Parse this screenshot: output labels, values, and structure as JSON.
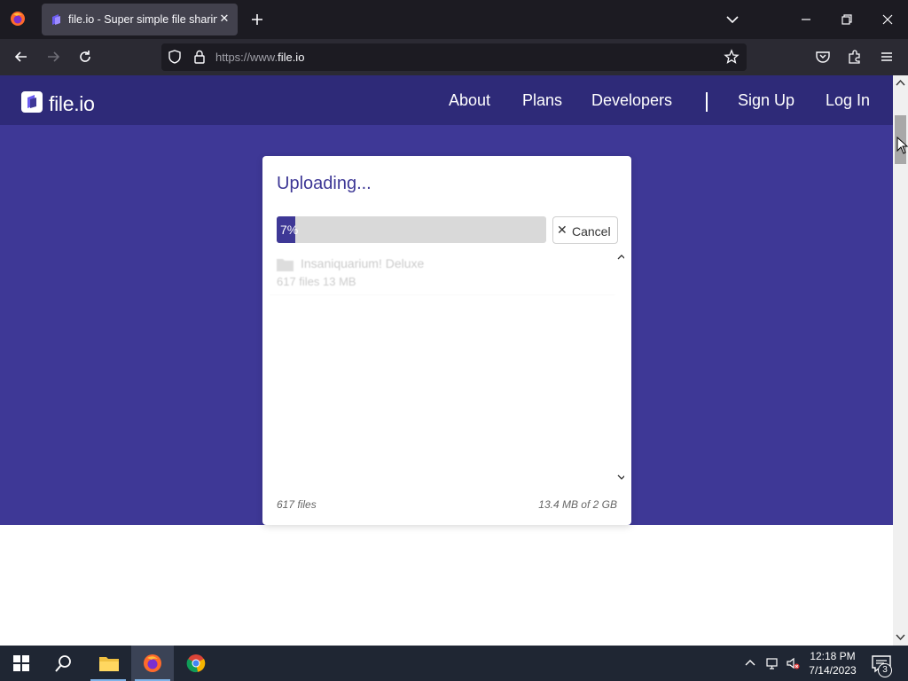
{
  "browser": {
    "tab": {
      "title": "file.io - Super simple file sharing"
    },
    "url": {
      "prefix": "https://www.",
      "domain": "file.io"
    }
  },
  "site": {
    "logo_text": "file.io",
    "nav": {
      "about": "About",
      "plans": "Plans",
      "developers": "Developers",
      "signup": "Sign Up",
      "login": "Log In"
    },
    "colors": {
      "header": "#2e2a78",
      "hero": "#3e3896",
      "accent": "#3e3896"
    }
  },
  "upload": {
    "title": "Uploading...",
    "progress_percent": 7,
    "progress_label": "7%",
    "cancel_label": "Cancel",
    "files": [
      {
        "name": "Insaniquarium! Deluxe",
        "meta": "617 files 13 MB",
        "icon": "folder-icon"
      }
    ],
    "footer": {
      "count": "617 files",
      "size": "13.4 MB of 2 GB"
    }
  },
  "taskbar": {
    "clock": {
      "time": "12:18 PM",
      "date": "7/14/2023"
    },
    "notification_count": "3"
  }
}
